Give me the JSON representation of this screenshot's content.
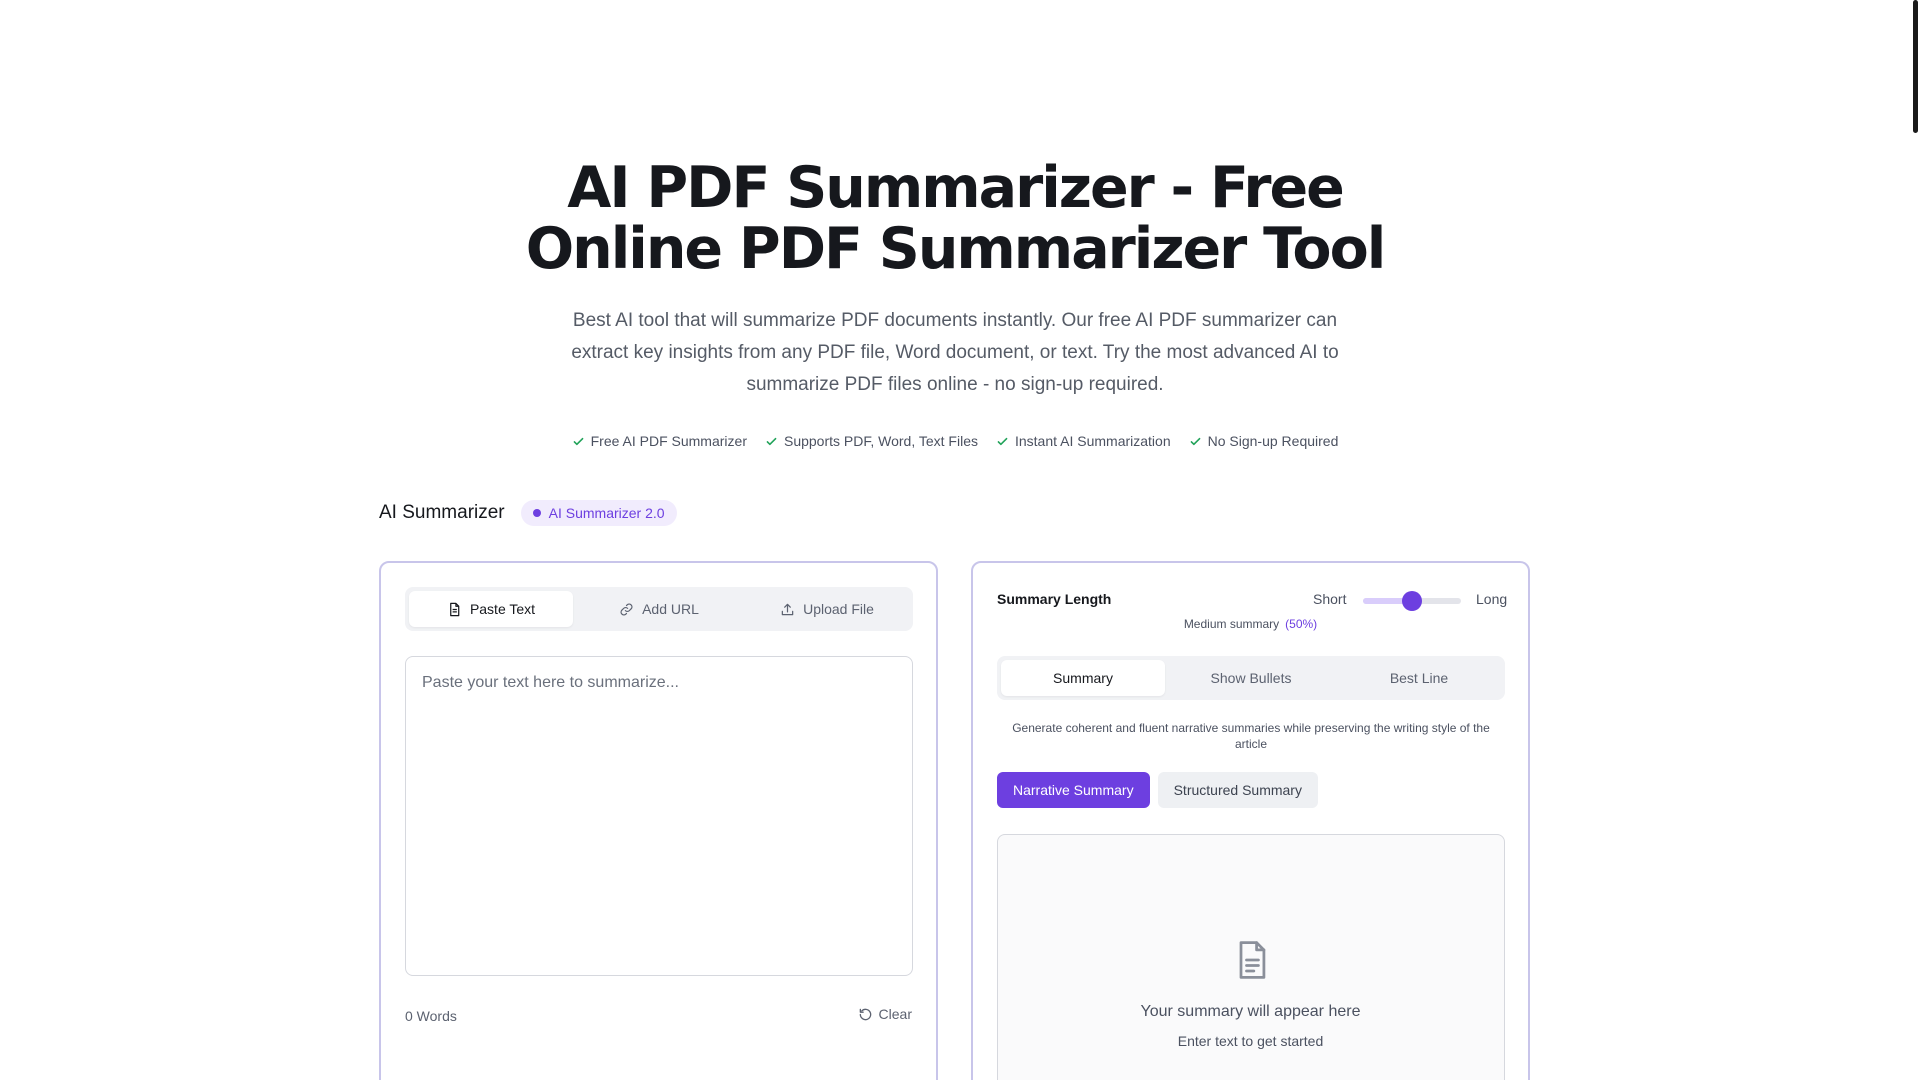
{
  "hero": {
    "title_line1": "AI PDF Summarizer - Free",
    "title_line2": "Online PDF Summarizer Tool",
    "description": "Best AI tool that will summarize PDF documents instantly. Our free AI PDF summarizer can extract key insights from any PDF file, Word document, or text. Try the most advanced AI to summarize PDF files online - no sign-up required."
  },
  "features": [
    {
      "label": "Free AI PDF Summarizer",
      "icon": "check-icon"
    },
    {
      "label": "Supports PDF, Word, Text Files",
      "icon": "check-icon"
    },
    {
      "label": "Instant AI Summarization",
      "icon": "check-icon"
    },
    {
      "label": "No Sign-up Required",
      "icon": "check-icon"
    }
  ],
  "section": {
    "title": "AI Summarizer",
    "badge": "AI Summarizer 2.0"
  },
  "input_panel": {
    "tabs": [
      {
        "label": "Paste Text",
        "icon": "document-icon",
        "active": true
      },
      {
        "label": "Add URL",
        "icon": "link-icon",
        "active": false
      },
      {
        "label": "Upload File",
        "icon": "upload-icon",
        "active": false
      }
    ],
    "textarea": {
      "value": "",
      "placeholder": "Paste your text here to summarize..."
    },
    "word_count": "0 Words",
    "clear_label": "Clear"
  },
  "output_panel": {
    "length": {
      "label": "Summary Length",
      "short_label": "Short",
      "long_label": "Long",
      "level_percent": 50,
      "info": "Medium summary",
      "info_pct": "(50%)"
    },
    "mode_tabs": [
      {
        "label": "Summary",
        "active": true
      },
      {
        "label": "Show Bullets",
        "active": false
      },
      {
        "label": "Best Line",
        "active": false
      }
    ],
    "mode_description": "Generate coherent and fluent narrative summaries while preserving the writing style of the article",
    "style_buttons": [
      {
        "label": "Narrative Summary",
        "active": true
      },
      {
        "label": "Structured Summary",
        "active": false
      }
    ],
    "empty_state": {
      "icon": "document-icon",
      "title": "Your summary will appear here",
      "subtitle": "Enter text to get started"
    }
  },
  "colors": {
    "accent": "#6d3fe0",
    "check": "#22a35a",
    "panel_border": "#c8c5ea"
  }
}
